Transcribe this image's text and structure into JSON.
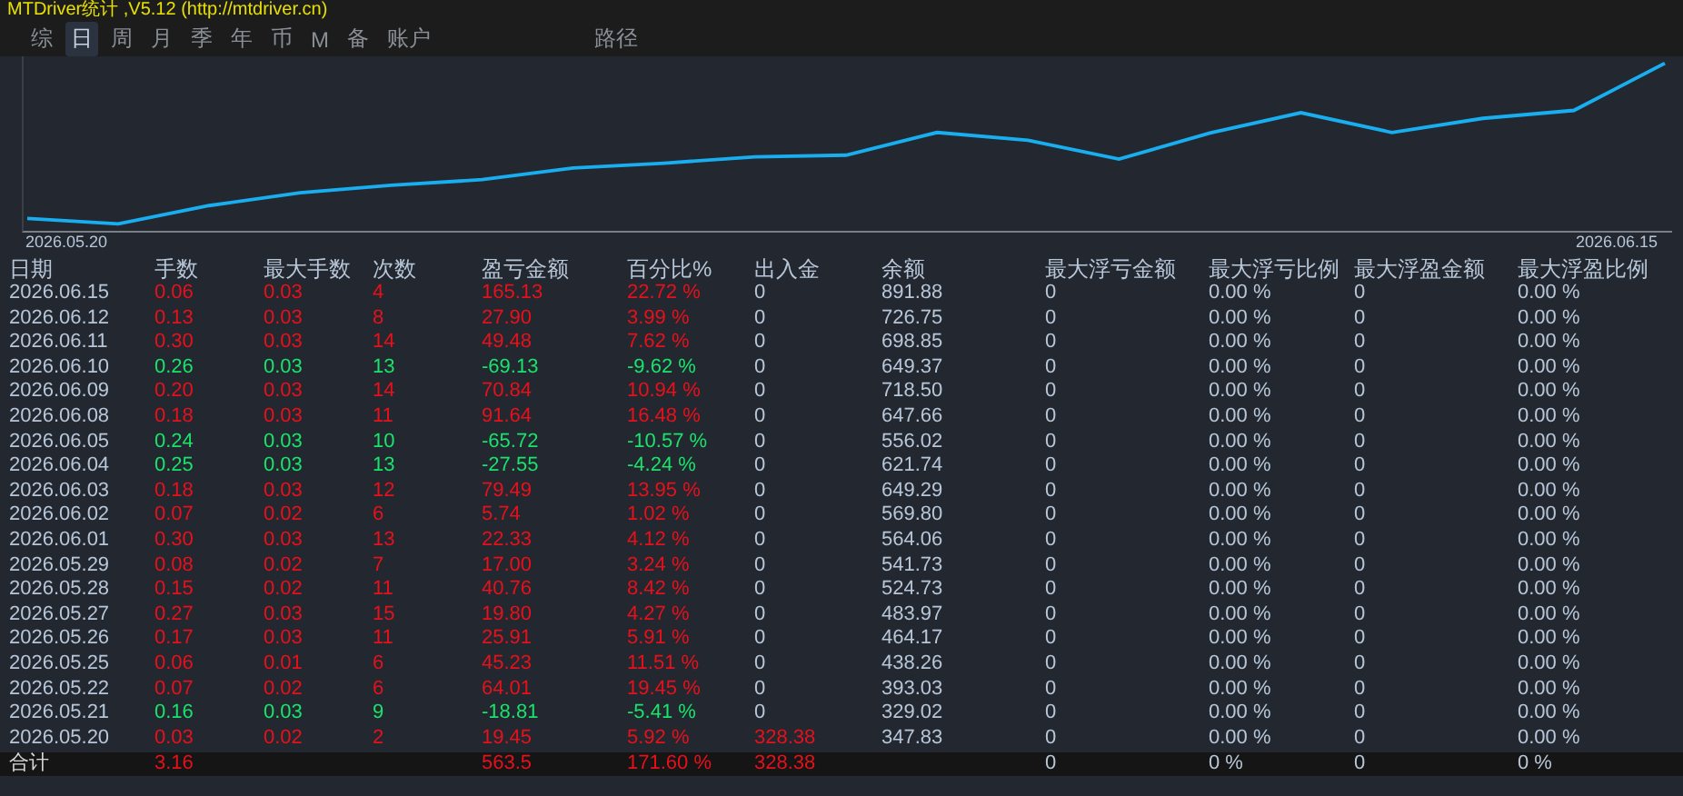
{
  "window": {
    "title": "MTDriver统计 ,V5.12 (http://mtdriver.cn)"
  },
  "tabs": [
    {
      "label": "综",
      "selected": false
    },
    {
      "label": "日",
      "selected": true
    },
    {
      "label": "周",
      "selected": false
    },
    {
      "label": "月",
      "selected": false
    },
    {
      "label": "季",
      "selected": false
    },
    {
      "label": "年",
      "selected": false
    },
    {
      "label": "币",
      "selected": false
    },
    {
      "label": "M",
      "selected": false
    },
    {
      "label": "备",
      "selected": false
    },
    {
      "label": "账户",
      "selected": false
    },
    {
      "label": "路径",
      "selected": false
    }
  ],
  "chart": {
    "start_label": "2026.05.20",
    "end_label": "2026.06.15"
  },
  "table": {
    "columns": [
      "日期",
      "手数",
      "最大手数",
      "次数",
      "盈亏金额",
      "百分比%",
      "出入金",
      "余额",
      "最大浮亏金额",
      "最大浮亏比例",
      "最大浮盈金额",
      "最大浮盈比例"
    ],
    "rows": [
      {
        "kind": "gain",
        "deposit": false,
        "cells": [
          "2026.06.15",
          "0.06",
          "0.03",
          "4",
          "165.13",
          "22.72 %",
          "0",
          "891.88",
          "0",
          "0.00 %",
          "0",
          "0.00 %"
        ]
      },
      {
        "kind": "gain",
        "deposit": false,
        "cells": [
          "2026.06.12",
          "0.13",
          "0.03",
          "8",
          "27.90",
          "3.99 %",
          "0",
          "726.75",
          "0",
          "0.00 %",
          "0",
          "0.00 %"
        ]
      },
      {
        "kind": "gain",
        "deposit": false,
        "cells": [
          "2026.06.11",
          "0.30",
          "0.03",
          "14",
          "49.48",
          "7.62 %",
          "0",
          "698.85",
          "0",
          "0.00 %",
          "0",
          "0.00 %"
        ]
      },
      {
        "kind": "loss",
        "deposit": false,
        "cells": [
          "2026.06.10",
          "0.26",
          "0.03",
          "13",
          "-69.13",
          "-9.62 %",
          "0",
          "649.37",
          "0",
          "0.00 %",
          "0",
          "0.00 %"
        ]
      },
      {
        "kind": "gain",
        "deposit": false,
        "cells": [
          "2026.06.09",
          "0.20",
          "0.03",
          "14",
          "70.84",
          "10.94 %",
          "0",
          "718.50",
          "0",
          "0.00 %",
          "0",
          "0.00 %"
        ]
      },
      {
        "kind": "gain",
        "deposit": false,
        "cells": [
          "2026.06.08",
          "0.18",
          "0.03",
          "11",
          "91.64",
          "16.48 %",
          "0",
          "647.66",
          "0",
          "0.00 %",
          "0",
          "0.00 %"
        ]
      },
      {
        "kind": "loss",
        "deposit": false,
        "cells": [
          "2026.06.05",
          "0.24",
          "0.03",
          "10",
          "-65.72",
          "-10.57 %",
          "0",
          "556.02",
          "0",
          "0.00 %",
          "0",
          "0.00 %"
        ]
      },
      {
        "kind": "loss",
        "deposit": false,
        "cells": [
          "2026.06.04",
          "0.25",
          "0.03",
          "13",
          "-27.55",
          "-4.24 %",
          "0",
          "621.74",
          "0",
          "0.00 %",
          "0",
          "0.00 %"
        ]
      },
      {
        "kind": "gain",
        "deposit": false,
        "cells": [
          "2026.06.03",
          "0.18",
          "0.03",
          "12",
          "79.49",
          "13.95 %",
          "0",
          "649.29",
          "0",
          "0.00 %",
          "0",
          "0.00 %"
        ]
      },
      {
        "kind": "gain",
        "deposit": false,
        "cells": [
          "2026.06.02",
          "0.07",
          "0.02",
          "6",
          "5.74",
          "1.02 %",
          "0",
          "569.80",
          "0",
          "0.00 %",
          "0",
          "0.00 %"
        ]
      },
      {
        "kind": "gain",
        "deposit": false,
        "cells": [
          "2026.06.01",
          "0.30",
          "0.03",
          "13",
          "22.33",
          "4.12 %",
          "0",
          "564.06",
          "0",
          "0.00 %",
          "0",
          "0.00 %"
        ]
      },
      {
        "kind": "gain",
        "deposit": false,
        "cells": [
          "2026.05.29",
          "0.08",
          "0.02",
          "7",
          "17.00",
          "3.24 %",
          "0",
          "541.73",
          "0",
          "0.00 %",
          "0",
          "0.00 %"
        ]
      },
      {
        "kind": "gain",
        "deposit": false,
        "cells": [
          "2026.05.28",
          "0.15",
          "0.02",
          "11",
          "40.76",
          "8.42 %",
          "0",
          "524.73",
          "0",
          "0.00 %",
          "0",
          "0.00 %"
        ]
      },
      {
        "kind": "gain",
        "deposit": false,
        "cells": [
          "2026.05.27",
          "0.27",
          "0.03",
          "15",
          "19.80",
          "4.27 %",
          "0",
          "483.97",
          "0",
          "0.00 %",
          "0",
          "0.00 %"
        ]
      },
      {
        "kind": "gain",
        "deposit": false,
        "cells": [
          "2026.05.26",
          "0.17",
          "0.03",
          "11",
          "25.91",
          "5.91 %",
          "0",
          "464.17",
          "0",
          "0.00 %",
          "0",
          "0.00 %"
        ]
      },
      {
        "kind": "gain",
        "deposit": false,
        "cells": [
          "2026.05.25",
          "0.06",
          "0.01",
          "6",
          "45.23",
          "11.51 %",
          "0",
          "438.26",
          "0",
          "0.00 %",
          "0",
          "0.00 %"
        ]
      },
      {
        "kind": "gain",
        "deposit": false,
        "cells": [
          "2026.05.22",
          "0.07",
          "0.02",
          "6",
          "64.01",
          "19.45 %",
          "0",
          "393.03",
          "0",
          "0.00 %",
          "0",
          "0.00 %"
        ]
      },
      {
        "kind": "loss",
        "deposit": false,
        "cells": [
          "2026.05.21",
          "0.16",
          "0.03",
          "9",
          "-18.81",
          "-5.41 %",
          "0",
          "329.02",
          "0",
          "0.00 %",
          "0",
          "0.00 %"
        ]
      },
      {
        "kind": "gain",
        "deposit": true,
        "cells": [
          "2026.05.20",
          "0.03",
          "0.02",
          "2",
          "19.45",
          "5.92 %",
          "328.38",
          "347.83",
          "0",
          "0.00 %",
          "0",
          "0.00 %"
        ]
      }
    ],
    "total": {
      "label": "合计",
      "lots": "3.16",
      "pnl": "563.5",
      "percent": "171.60 %",
      "flow": "328.38",
      "max_float_loss": "0",
      "max_float_loss_ratio": "0 %",
      "max_float_profit": "0",
      "max_float_profit_ratio": "0 %"
    }
  }
}
